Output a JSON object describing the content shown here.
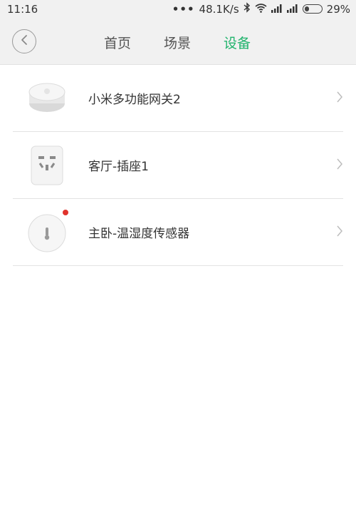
{
  "status_bar": {
    "time": "11:16",
    "dots": "•••",
    "network_speed": "48.1K/s",
    "battery_percent_text": "29%",
    "battery_level": 0.29,
    "icons": [
      "bluetooth-icon",
      "wifi-icon",
      "signal-icon",
      "signal-icon",
      "battery-icon"
    ]
  },
  "header": {
    "back_icon": "chevron-left-icon",
    "tabs": [
      {
        "label": "首页",
        "active": false
      },
      {
        "label": "场景",
        "active": false
      },
      {
        "label": "设备",
        "active": true
      }
    ],
    "active_color": "#20b36c"
  },
  "devices": [
    {
      "name": "小米多功能网关2",
      "icon": "gateway-icon",
      "has_notification": false
    },
    {
      "name": "客厅-插座1",
      "icon": "power-socket-icon",
      "has_notification": false
    },
    {
      "name": "主卧-温湿度传感器",
      "icon": "temperature-sensor-icon",
      "has_notification": true
    }
  ],
  "notification_color": "#e0332d"
}
